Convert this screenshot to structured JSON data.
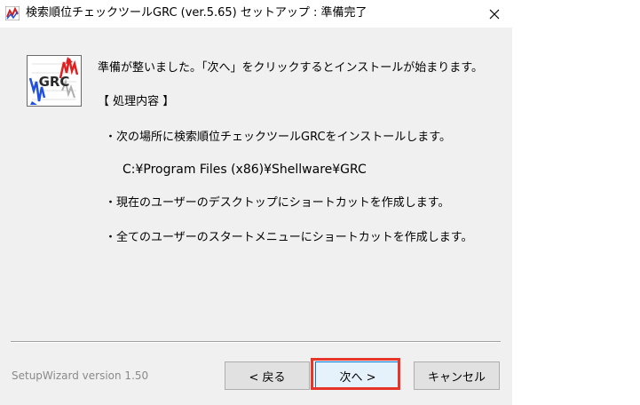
{
  "window": {
    "title": "検索順位チェックツールGRC (ver.5.65)  セットアップ : 準備完了"
  },
  "logo": {
    "icon": "grc-logo-icon",
    "text": "GRC"
  },
  "content": {
    "intro": "準備が整いました。「次へ」をクリックするとインストールが始まります。",
    "section_heading": "【 処理内容 】",
    "item1": "・次の場所に検索順位チェックツールGRCをインストールします。",
    "install_path": "C:¥Program Files (x86)¥Shellware¥GRC",
    "item2": "・現在のユーザーのデスクトップにショートカットを作成します。",
    "item3": "・全てのユーザーのスタートメニューにショートカットを作成します。"
  },
  "footer": {
    "version": "SetupWizard version 1.50"
  },
  "buttons": {
    "back": "< 戻る",
    "next": "次へ >",
    "cancel": "キャンセル"
  },
  "colors": {
    "highlight": "#e8352a",
    "dialog_bg": "#f0f0f0"
  }
}
